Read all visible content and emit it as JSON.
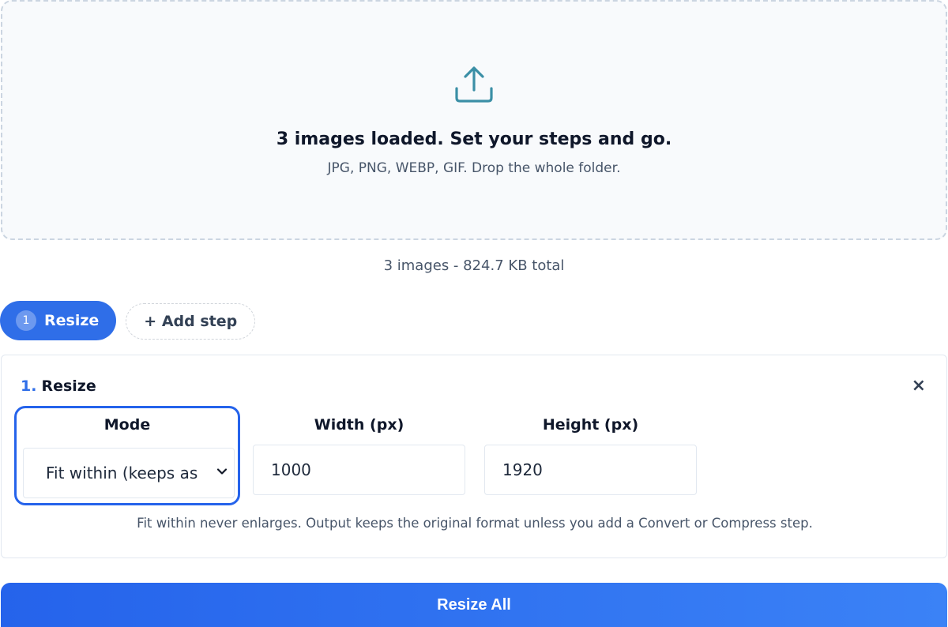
{
  "dropzone": {
    "title": "3 images loaded. Set your steps and go.",
    "subtitle": "JPG, PNG, WEBP, GIF. Drop the whole folder.",
    "icon": "upload-icon",
    "accent": "#3b8fa6"
  },
  "summary": "3 images - 824.7 KB total",
  "steps": {
    "active": {
      "number": "1",
      "label": "Resize"
    },
    "add_label": "+ Add step"
  },
  "card": {
    "number": "1.",
    "title": "Resize",
    "close_label": "×",
    "mode": {
      "label": "Mode",
      "value": "Fit within (keeps as"
    },
    "width": {
      "label": "Width (px)",
      "value": "1000"
    },
    "height": {
      "label": "Height (px)",
      "value": "1920"
    },
    "hint": "Fit within never enlarges. Output keeps the original format unless you add a Convert or Compress step."
  },
  "primary_button": "Resize All",
  "colors": {
    "brand": "#2f6ee8",
    "focus": "#2563eb",
    "border": "#e2e8f0"
  }
}
